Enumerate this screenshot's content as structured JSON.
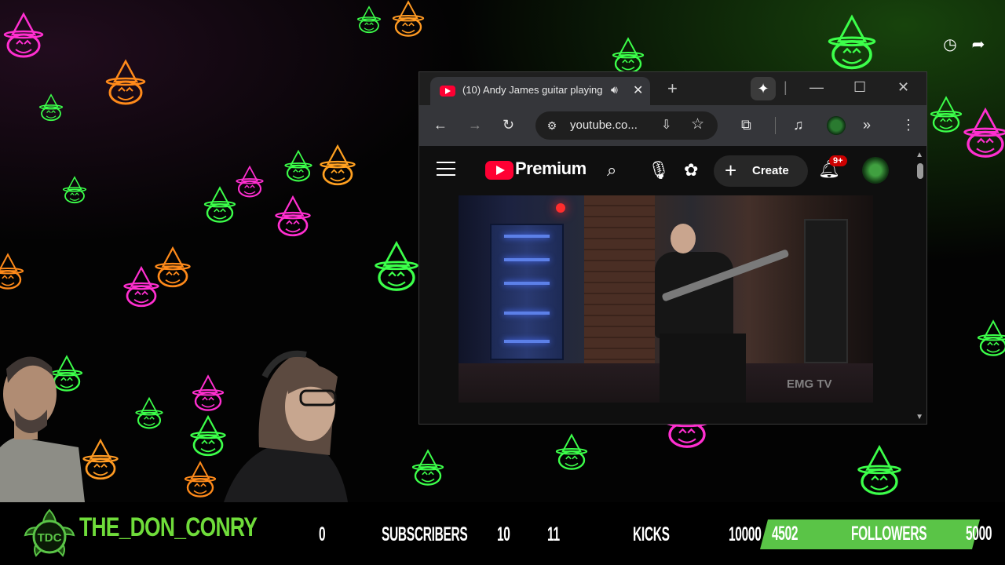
{
  "browser": {
    "tab_title": "(10) Andy James guitar playing",
    "new_tab_label": "+",
    "url": "youtube.co..."
  },
  "youtube": {
    "brand": "Premium",
    "create_label": "Create",
    "notification_count": "9+",
    "video_watermark": "EMG TV"
  },
  "stream_overlay": {
    "channel_name": "THE_DON_CONRY",
    "logo_text": "TDC",
    "subscribers_current": "0",
    "subscribers_label": "SUBSCRIBERS",
    "subscribers_goal": "10",
    "kicks_current": "11",
    "kicks_label": "KICKS",
    "kicks_goal": "10000",
    "followers_current": "4502",
    "followers_label": "FOLLOWERS",
    "followers_goal": "5000",
    "followers_progress": 0.9,
    "accent_color": "#5ac447",
    "channel_color": "#6fdc3a"
  },
  "icons": {
    "top_right": [
      "clock-icon",
      "share-icon"
    ]
  }
}
